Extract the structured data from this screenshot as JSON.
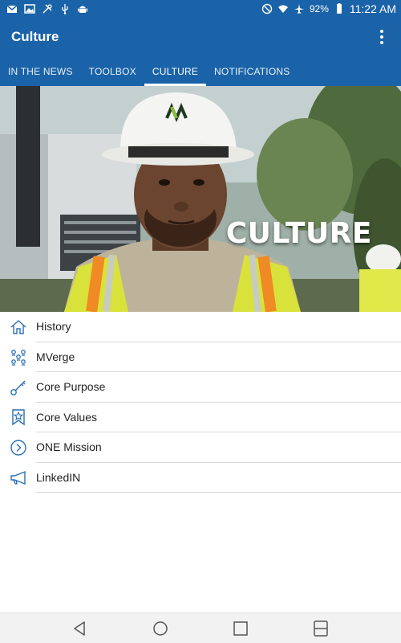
{
  "status_bar": {
    "battery": "92%",
    "time": "11:22 AM",
    "left_icons": [
      "gmail-icon",
      "gallery-icon",
      "tools-icon",
      "usb-icon",
      "android-icon"
    ],
    "right_icons": [
      "do-not-disturb-icon",
      "wifi-icon",
      "airplane-icon",
      "battery-icon"
    ]
  },
  "app_bar": {
    "title": "Culture",
    "menu_icon": "overflow-menu-icon"
  },
  "tabs": [
    {
      "label": "IN THE NEWS",
      "active": false
    },
    {
      "label": "TOOLBOX",
      "active": false
    },
    {
      "label": "CULTURE",
      "active": true
    },
    {
      "label": "NOTIFICATIONS",
      "active": false
    }
  ],
  "hero": {
    "title": "CULTURE",
    "image": "worker-in-hard-hat-and-safety-vest"
  },
  "menu": [
    {
      "label": "History",
      "icon": "home-icon"
    },
    {
      "label": "MVerge",
      "icon": "people-network-icon"
    },
    {
      "label": "Core Purpose",
      "icon": "key-icon"
    },
    {
      "label": "Core Values",
      "icon": "star-bookmark-icon"
    },
    {
      "label": "ONE Mission",
      "icon": "arrow-circle-icon"
    },
    {
      "label": "LinkedIN",
      "icon": "megaphone-icon"
    }
  ],
  "nav_bar": {
    "buttons": [
      "back-icon",
      "home-circle-icon",
      "recents-icon",
      "dual-window-icon"
    ]
  },
  "colors": {
    "primary": "#1b63a8",
    "icon_blue": "#2a6fb5",
    "vest_yellow": "#d8e23a",
    "vest_orange": "#f08a24"
  }
}
